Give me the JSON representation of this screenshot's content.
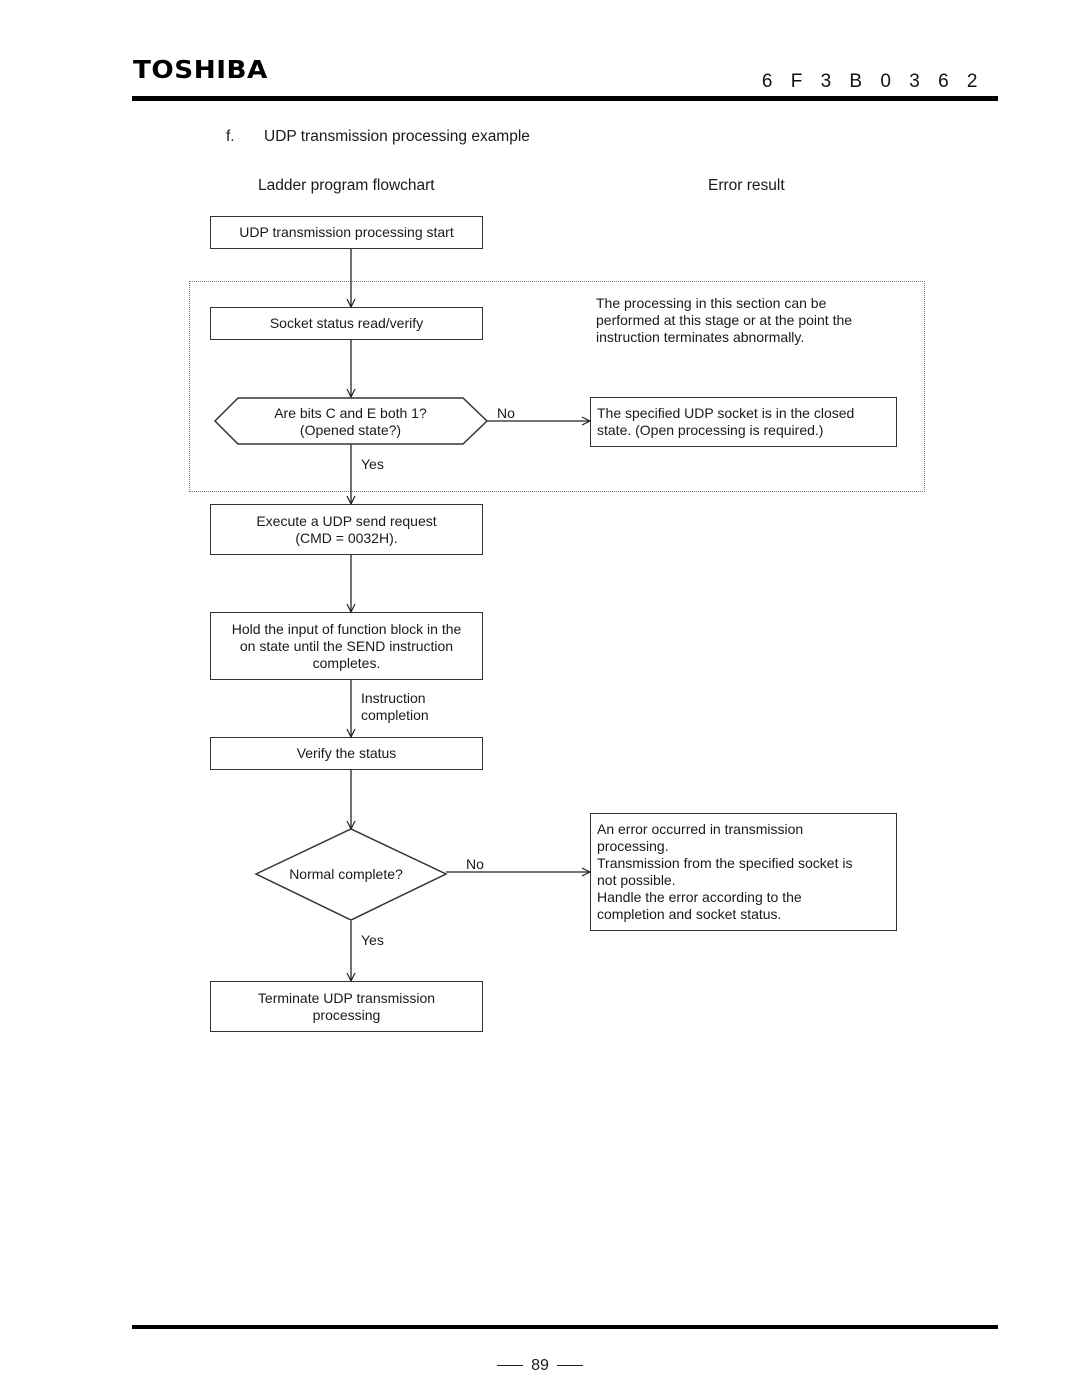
{
  "header": {
    "brand": "TOSHIBA",
    "document_number": "6 F 3 B 0 3 6 2"
  },
  "section": {
    "label": "f.",
    "title": "UDP transmission processing example"
  },
  "columns": {
    "left": "Ladder program flowchart",
    "right": "Error result"
  },
  "flowchart": {
    "start": "UDP transmission processing start",
    "socket_status": "Socket status read/verify",
    "section_note": "The processing in this section can be\nperformed at this stage or at the point the\ninstruction terminates abnormally.",
    "decision_opened": "Are bits C and E both 1?\n(Opened state?)",
    "decision_opened_no": "No",
    "decision_opened_yes": "Yes",
    "error_closed": "The specified UDP socket is in the closed\nstate. (Open processing is required.)",
    "send_request": "Execute a UDP send request\n(CMD = 0032H).",
    "hold_input": "Hold the input of function block in the\non state until the SEND instruction\ncompletes.",
    "instruction_completion": "Instruction\ncompletion",
    "verify_status": "Verify the status",
    "decision_normal": "Normal complete?",
    "decision_normal_no": "No",
    "decision_normal_yes": "Yes",
    "error_transmission": "An error occurred in transmission\nprocessing.\nTransmission from the specified socket is\nnot possible.\nHandle the error according to the\ncompletion and socket status.",
    "terminate": "Terminate UDP transmission\nprocessing"
  },
  "footer": {
    "page_number": "89"
  }
}
